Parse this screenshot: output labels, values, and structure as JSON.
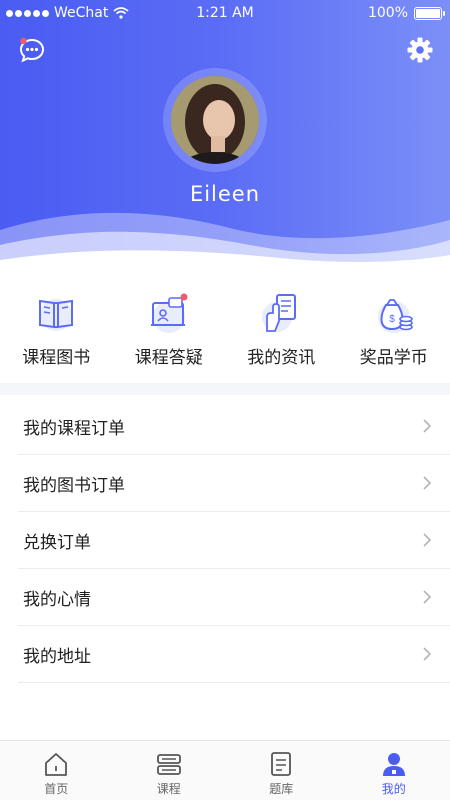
{
  "status": {
    "carrier": "WeChat",
    "time": "1:21 AM",
    "battery": "100%",
    "battery_level": 1.0
  },
  "profile": {
    "name": "Eileen"
  },
  "quick_links": [
    {
      "label": "课程图书",
      "icon": "book-icon"
    },
    {
      "label": "课程答疑",
      "icon": "qa-screen-icon"
    },
    {
      "label": "我的资讯",
      "icon": "document-hand-icon"
    },
    {
      "label": "奖品学币",
      "icon": "money-bag-icon"
    }
  ],
  "menu": [
    {
      "label": "我的课程订单"
    },
    {
      "label": "我的图书订单"
    },
    {
      "label": "兑换订单"
    },
    {
      "label": "我的心情"
    },
    {
      "label": "我的地址"
    }
  ],
  "tabs": [
    {
      "label": "首页",
      "icon": "home-icon"
    },
    {
      "label": "课程",
      "icon": "course-icon"
    },
    {
      "label": "题库",
      "icon": "question-bank-icon"
    },
    {
      "label": "我的",
      "icon": "profile-icon"
    }
  ],
  "colors": {
    "accent": "#4a5cf2",
    "badge": "#f25a6e"
  }
}
